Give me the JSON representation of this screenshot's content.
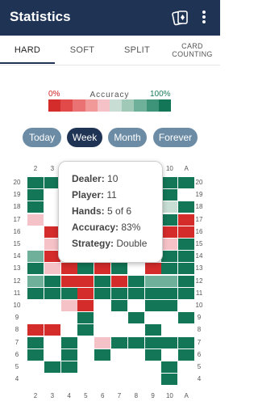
{
  "appbar": {
    "title": "Statistics",
    "cards_icon": "playing-cards-icon",
    "more_icon": "more-vert-icon"
  },
  "tabs": [
    {
      "label": "HARD",
      "active": true
    },
    {
      "label": "SOFT",
      "active": false
    },
    {
      "label": "SPLIT",
      "active": false
    },
    {
      "label": "CARD COUNTING",
      "active": false
    }
  ],
  "accuracy_legend": {
    "title": "Accuracy",
    "min_label": "0%",
    "max_label": "100%",
    "colors": [
      "#d42b2b",
      "#e24a4a",
      "#ea7272",
      "#f19999",
      "#f5c2c8",
      "#c8ddd4",
      "#a0c9b8",
      "#6fb09a",
      "#3d9479",
      "#137656"
    ]
  },
  "time_ranges": [
    {
      "label": "Today",
      "selected": false
    },
    {
      "label": "Week",
      "selected": true
    },
    {
      "label": "Month",
      "selected": false
    },
    {
      "label": "Forever",
      "selected": false
    }
  ],
  "grid": {
    "dealer_cards": [
      "2",
      "3",
      "4",
      "5",
      "6",
      "7",
      "8",
      "9",
      "10",
      "A"
    ],
    "player_totals": [
      "20",
      "19",
      "18",
      "17",
      "16",
      "15",
      "14",
      "13",
      "12",
      "11",
      "10",
      "9",
      "8",
      "7",
      "6",
      "5",
      "4"
    ],
    "rows": [
      [
        "G",
        "G",
        ".",
        ".",
        ".",
        ".",
        ".",
        ".",
        "G",
        "G"
      ],
      [
        "G",
        ".",
        ".",
        ".",
        ".",
        ".",
        ".",
        ".",
        "G",
        "."
      ],
      [
        "G",
        ".",
        ".",
        ".",
        ".",
        ".",
        ".",
        ".",
        "L",
        "G"
      ],
      [
        "P",
        ".",
        ".",
        ".",
        ".",
        ".",
        ".",
        ".",
        "G",
        "R"
      ],
      [
        ".",
        "R",
        ".",
        ".",
        ".",
        ".",
        ".",
        ".",
        "R",
        "R"
      ],
      [
        ".",
        "P",
        ".",
        ".",
        ".",
        ".",
        ".",
        ".",
        "P",
        "G"
      ],
      [
        "M",
        "R",
        ".",
        ".",
        ".",
        ".",
        ".",
        ".",
        "G",
        "G"
      ],
      [
        "G",
        "P",
        "R",
        "G",
        "R",
        "G",
        ".",
        "R",
        "G",
        "G"
      ],
      [
        "M",
        "G",
        "R",
        "R",
        "G",
        "R",
        "G",
        "M",
        "M",
        "G"
      ],
      [
        "G",
        "G",
        "G",
        "R",
        "G",
        "G",
        "G",
        "G",
        "G",
        "G"
      ],
      [
        ".",
        ".",
        "P",
        "R",
        ".",
        "G",
        ".",
        "G",
        "G",
        "."
      ],
      [
        ".",
        ".",
        ".",
        "G",
        ".",
        ".",
        "G",
        ".",
        ".",
        "G"
      ],
      [
        "R",
        "R",
        ".",
        "G",
        ".",
        ".",
        ".",
        "G",
        ".",
        "."
      ],
      [
        "G",
        ".",
        "G",
        ".",
        "P",
        "G",
        "G",
        "G",
        "G",
        "G"
      ],
      [
        "G",
        ".",
        "G",
        ".",
        "G",
        ".",
        ".",
        "G",
        ".",
        "G"
      ],
      [
        ".",
        "G",
        "G",
        ".",
        ".",
        ".",
        ".",
        ".",
        "G",
        "."
      ],
      [
        ".",
        ".",
        ".",
        ".",
        ".",
        ".",
        ".",
        ".",
        "G",
        "."
      ]
    ]
  },
  "tooltip": {
    "dealer_label": "Dealer:",
    "dealer_value": "10",
    "player_label": "Player:",
    "player_value": "11",
    "hands_label": "Hands:",
    "hands_value": "5 of 6",
    "accuracy_label": "Accuracy:",
    "accuracy_value": "83%",
    "strategy_label": "Strategy:",
    "strategy_value": "Double"
  },
  "cell_colors": {
    "G": "#137656",
    "R": "#d42b2b",
    "P": "#f5c2c8",
    "M": "#6fb09a",
    "L": "#c8ddd4"
  }
}
